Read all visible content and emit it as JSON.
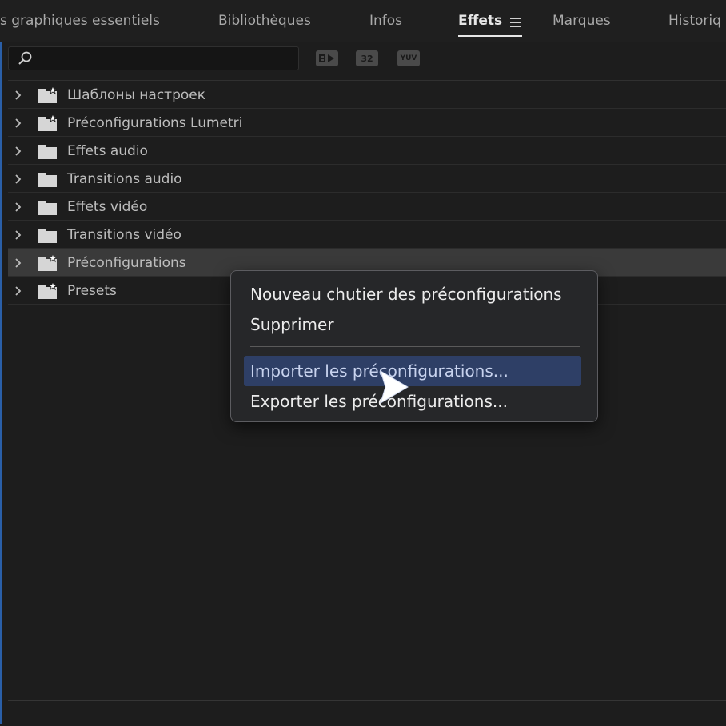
{
  "tabs": [
    {
      "label": "s graphiques essentiels"
    },
    {
      "label": "Bibliothèques"
    },
    {
      "label": "Infos"
    },
    {
      "label": "Effets"
    },
    {
      "label": "Marques"
    },
    {
      "label": "Historiq"
    }
  ],
  "active_tab": "Effets",
  "search": {
    "placeholder": "",
    "value": ""
  },
  "toolbar": {
    "accelerated_label": "",
    "bit32_label": "32",
    "yuv_label": "YUV"
  },
  "tree": {
    "items": [
      {
        "label": "Шаблоны настроек",
        "icon": "preset-folder-icon"
      },
      {
        "label": "Préconfigurations Lumetri",
        "icon": "preset-folder-icon"
      },
      {
        "label": "Effets audio",
        "icon": "folder-icon"
      },
      {
        "label": "Transitions audio",
        "icon": "folder-icon"
      },
      {
        "label": "Effets vidéo",
        "icon": "folder-icon"
      },
      {
        "label": "Transitions vidéo",
        "icon": "folder-icon"
      },
      {
        "label": "Préconfigurations",
        "icon": "preset-folder-icon",
        "selected": true
      },
      {
        "label": "Presets",
        "icon": "preset-folder-icon"
      }
    ]
  },
  "context_menu": {
    "items": [
      {
        "label": "Nouveau chutier des préconfigurations"
      },
      {
        "label": "Supprimer"
      },
      {
        "label": "Importer les préconfigurations..."
      },
      {
        "label": "Exporter les préconfigurations..."
      }
    ],
    "highlighted": "Importer les préconfigurations..."
  },
  "colors": {
    "background": "#1d1d1d",
    "highlight_row": "#3a3a3a",
    "menu_highlight": "#2e3f66",
    "accent_border": "#2a5fa8"
  }
}
